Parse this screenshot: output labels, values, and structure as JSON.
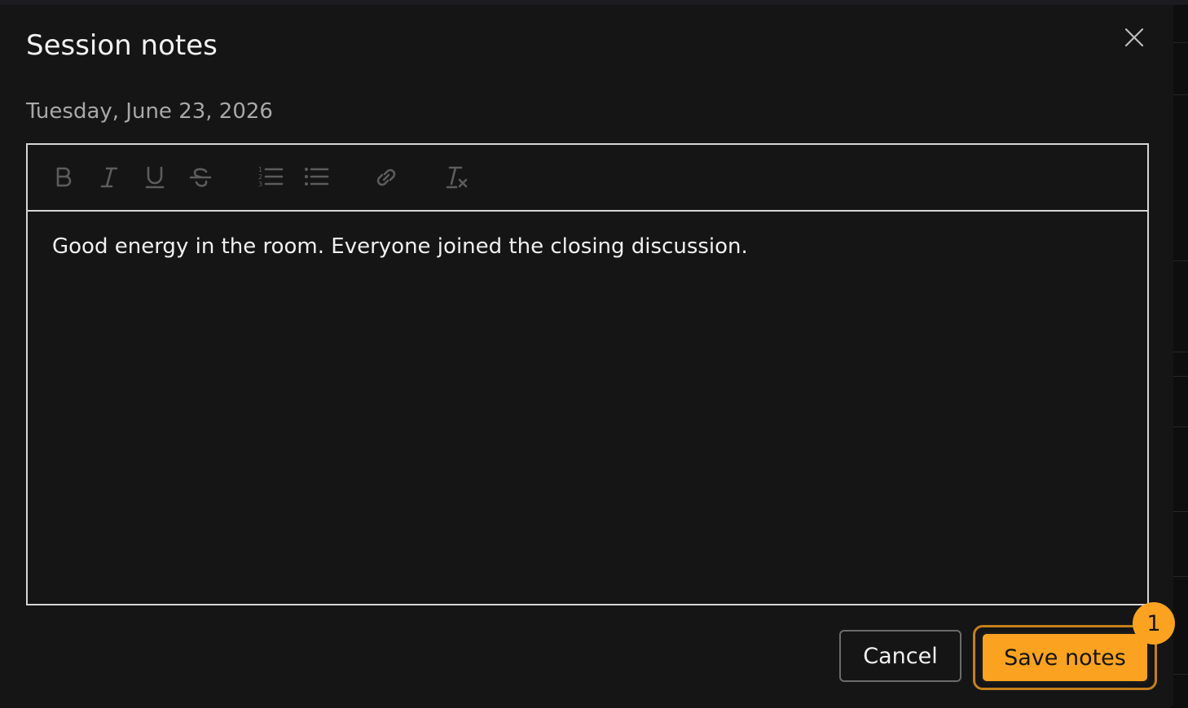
{
  "dialog": {
    "title": "Session notes",
    "date": "Tuesday, June 23, 2026"
  },
  "editor": {
    "toolbar": [
      {
        "name": "bold-button",
        "icon": "bold-icon",
        "tooltip": "Bold"
      },
      {
        "name": "italic-button",
        "icon": "italic-icon",
        "tooltip": "Italic"
      },
      {
        "name": "underline-button",
        "icon": "underline-icon",
        "tooltip": "Underline"
      },
      {
        "name": "strikethrough-button",
        "icon": "strikethrough-icon",
        "tooltip": "Strikethrough"
      },
      {
        "name": "ordered-list-button",
        "icon": "ordered-list-icon",
        "tooltip": "Numbered list"
      },
      {
        "name": "bullet-list-button",
        "icon": "bullet-list-icon",
        "tooltip": "Bulleted list"
      },
      {
        "name": "link-button",
        "icon": "link-icon",
        "tooltip": "Link"
      },
      {
        "name": "clear-format-button",
        "icon": "clear-format-icon",
        "tooltip": "Clear formatting"
      }
    ],
    "content": "Good energy in the room. Everyone joined the closing discussion."
  },
  "actions": {
    "cancel_label": "Cancel",
    "save_label": "Save notes",
    "badge": "1"
  },
  "colors": {
    "accent": "#fba320",
    "background": "#151516",
    "text": "#f0f0f0",
    "muted_text": "#a8a8a8",
    "icon_disabled": "#5c5c5c"
  }
}
